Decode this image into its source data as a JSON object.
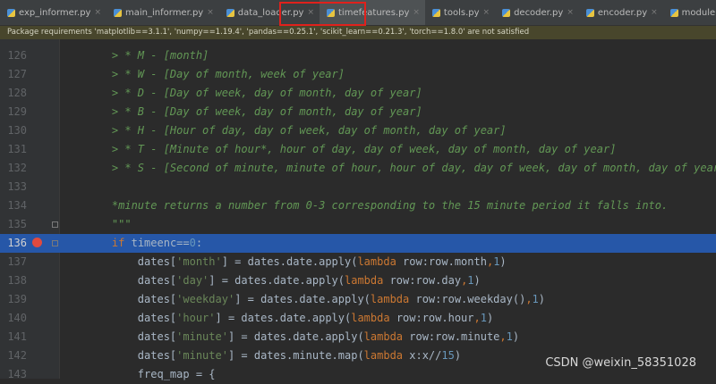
{
  "tabs": [
    {
      "label": "exp_informer.py",
      "active": false
    },
    {
      "label": "main_informer.py",
      "active": false
    },
    {
      "label": "data_loader.py",
      "active": false
    },
    {
      "label": "timefeatures.py",
      "active": true
    },
    {
      "label": "tools.py",
      "active": false
    },
    {
      "label": "decoder.py",
      "active": false
    },
    {
      "label": "encoder.py",
      "active": false
    },
    {
      "label": "module.py",
      "active": false
    }
  ],
  "tab_close_glyph": "×",
  "banner": {
    "text": "Package requirements 'matplotlib==3.1.1', 'numpy==1.19.4', 'pandas==0.25.1', 'scikit_learn==0.21.3', 'torch==1.8.0' are not satisfied"
  },
  "editor": {
    "current_line": 136,
    "breakpoint_line": 136,
    "lines": [
      {
        "n": "126",
        "segs": [
          {
            "t": "    > * M - [month]",
            "c": "doc"
          }
        ]
      },
      {
        "n": "127",
        "segs": [
          {
            "t": "    > * W - [Day of month, week of year]",
            "c": "doc"
          }
        ]
      },
      {
        "n": "128",
        "segs": [
          {
            "t": "    > * D - [Day of week, day of month, day of year]",
            "c": "doc"
          }
        ]
      },
      {
        "n": "129",
        "segs": [
          {
            "t": "    > * B - [Day of week, day of month, day of year]",
            "c": "doc"
          }
        ]
      },
      {
        "n": "130",
        "segs": [
          {
            "t": "    > * H - [Hour of day, day of week, day of month, day of year]",
            "c": "doc"
          }
        ]
      },
      {
        "n": "131",
        "segs": [
          {
            "t": "    > * T - [Minute of hour*, hour of day, day of week, day of month, day of year]",
            "c": "doc"
          }
        ]
      },
      {
        "n": "132",
        "segs": [
          {
            "t": "    > * S - [Second of minute, minute of hour, hour of day, day of week, day of month, day of year]",
            "c": "doc"
          }
        ]
      },
      {
        "n": "133",
        "segs": []
      },
      {
        "n": "134",
        "segs": [
          {
            "t": "    *minute returns a number from 0-3 corresponding to the 15 minute period it falls into.",
            "c": "doc"
          }
        ]
      },
      {
        "n": "135",
        "segs": [
          {
            "t": "    \"\"\"",
            "c": "doc"
          }
        ]
      },
      {
        "n": "136",
        "segs": [
          {
            "t": "    ",
            "c": "plain"
          },
          {
            "t": "if ",
            "c": "kw"
          },
          {
            "t": "timeenc==",
            "c": "plain"
          },
          {
            "t": "0",
            "c": "num"
          },
          {
            "t": ":",
            "c": "plain"
          }
        ]
      },
      {
        "n": "137",
        "segs": [
          {
            "t": "        dates[",
            "c": "plain"
          },
          {
            "t": "'month'",
            "c": "str"
          },
          {
            "t": "] = dates.date.apply(",
            "c": "plain"
          },
          {
            "t": "lambda ",
            "c": "kw"
          },
          {
            "t": "row:row.month",
            "c": "plain"
          },
          {
            "t": ",",
            "c": "kw"
          },
          {
            "t": "1",
            "c": "num"
          },
          {
            "t": ")",
            "c": "plain"
          }
        ]
      },
      {
        "n": "138",
        "segs": [
          {
            "t": "        dates[",
            "c": "plain"
          },
          {
            "t": "'day'",
            "c": "str"
          },
          {
            "t": "] = dates.date.apply(",
            "c": "plain"
          },
          {
            "t": "lambda ",
            "c": "kw"
          },
          {
            "t": "row:row.day",
            "c": "plain"
          },
          {
            "t": ",",
            "c": "kw"
          },
          {
            "t": "1",
            "c": "num"
          },
          {
            "t": ")",
            "c": "plain"
          }
        ]
      },
      {
        "n": "139",
        "segs": [
          {
            "t": "        dates[",
            "c": "plain"
          },
          {
            "t": "'weekday'",
            "c": "str"
          },
          {
            "t": "] = dates.date.apply(",
            "c": "plain"
          },
          {
            "t": "lambda ",
            "c": "kw"
          },
          {
            "t": "row:row.weekday()",
            "c": "plain"
          },
          {
            "t": ",",
            "c": "kw"
          },
          {
            "t": "1",
            "c": "num"
          },
          {
            "t": ")",
            "c": "plain"
          }
        ]
      },
      {
        "n": "140",
        "segs": [
          {
            "t": "        dates[",
            "c": "plain"
          },
          {
            "t": "'hour'",
            "c": "str"
          },
          {
            "t": "] = dates.date.apply(",
            "c": "plain"
          },
          {
            "t": "lambda ",
            "c": "kw"
          },
          {
            "t": "row:row.hour",
            "c": "plain"
          },
          {
            "t": ",",
            "c": "kw"
          },
          {
            "t": "1",
            "c": "num"
          },
          {
            "t": ")",
            "c": "plain"
          }
        ]
      },
      {
        "n": "141",
        "segs": [
          {
            "t": "        dates[",
            "c": "plain"
          },
          {
            "t": "'minute'",
            "c": "str"
          },
          {
            "t": "] = dates.date.apply(",
            "c": "plain"
          },
          {
            "t": "lambda ",
            "c": "kw"
          },
          {
            "t": "row:row.minute",
            "c": "plain"
          },
          {
            "t": ",",
            "c": "kw"
          },
          {
            "t": "1",
            "c": "num"
          },
          {
            "t": ")",
            "c": "plain"
          }
        ]
      },
      {
        "n": "142",
        "segs": [
          {
            "t": "        dates[",
            "c": "plain"
          },
          {
            "t": "'minute'",
            "c": "str"
          },
          {
            "t": "] = dates.minute.map(",
            "c": "plain"
          },
          {
            "t": "lambda ",
            "c": "kw"
          },
          {
            "t": "x:x//",
            "c": "plain"
          },
          {
            "t": "15",
            "c": "num"
          },
          {
            "t": ")",
            "c": "plain"
          }
        ]
      },
      {
        "n": "143",
        "segs": [
          {
            "t": "        freq_map = {",
            "c": "plain"
          }
        ]
      }
    ]
  },
  "watermark": "CSDN @weixin_58351028",
  "colors": {
    "tab_highlight_box": "#e0211c",
    "current_line_bg": "#2657a8",
    "breakpoint": "#e04a3f",
    "banner_bg": "#48462c"
  }
}
